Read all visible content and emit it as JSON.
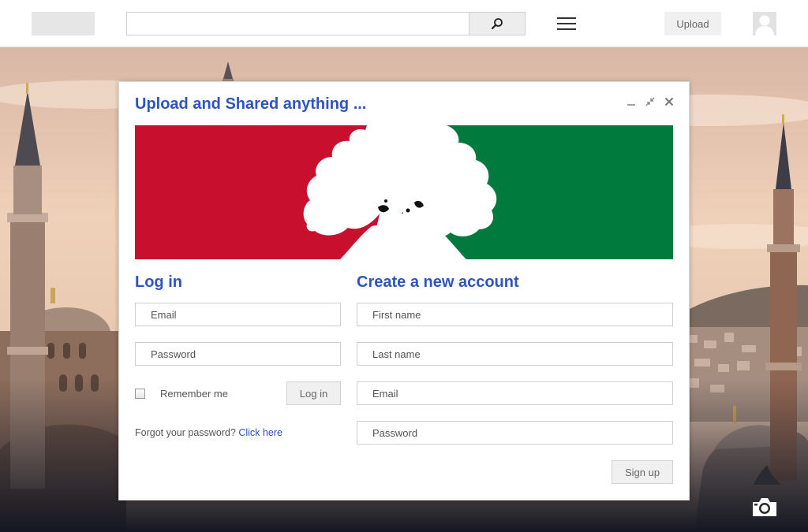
{
  "header": {
    "search": {
      "placeholder": "",
      "value": ""
    },
    "search_button_icon": "search-icon",
    "menu_icon": "hamburger-menu-icon",
    "upload_label": "Upload",
    "avatar_icon": "user-avatar-icon"
  },
  "modal": {
    "title": "Upload and Shared anything ...",
    "controls": [
      "minimize-icon",
      "collapse-icon",
      "close-icon"
    ],
    "banner": {
      "left_color": "#c8102e",
      "right_color": "#007a3d",
      "icon": "tree-silhouette-icon"
    }
  },
  "login": {
    "title": "Log in",
    "email_placeholder": "Email",
    "password_placeholder": "Password",
    "remember_label": "Remember me",
    "button_label": "Log in",
    "forgot_text": "Forgot your password?",
    "forgot_link": "Click here"
  },
  "signup": {
    "title": "Create a new account",
    "first_name_placeholder": "First name",
    "last_name_placeholder": "Last name",
    "email_placeholder": "Email",
    "password_placeholder": "Password",
    "button_label": "Sign up"
  },
  "camera_icon": "camera-icon",
  "colors": {
    "accent": "#2b55c7",
    "banner_red": "#c8102e",
    "banner_green": "#007a3d"
  }
}
